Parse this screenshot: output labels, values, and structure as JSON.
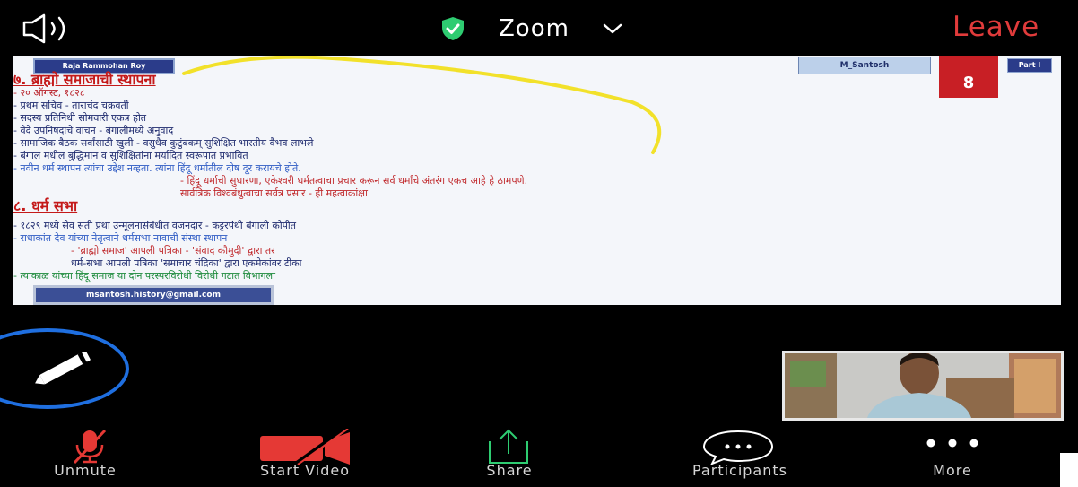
{
  "topbar": {
    "title": "Zoom",
    "leave_label": "Leave",
    "leave_color": "#e03b3b",
    "shield_color": "#2ecc71",
    "icons": [
      "speaker-icon",
      "encryption-shield-icon",
      "chevron-down-icon"
    ]
  },
  "slide": {
    "source_tag": "Raja Rammohan Roy",
    "presenter_tag": "M_Santosh",
    "page_number": "8",
    "part_label": "Part I",
    "section1_title": "७. ब्राह्मो समाजाची स्थापना",
    "section1_lines": [
      "- २० ऑगस्ट, १८२८",
      "- प्रथम सचिव - ताराचंद चक्रवर्ती",
      "- सदस्य प्रतिनिधी सोमवारी एकत्र होत",
      "- वेदे उपनिषदांचे वाचन - बंगालीमध्ये अनुवाद",
      "- सामाजिक बैठक सर्वांसाठी खुली - वसुधैव कुटुंबकम् सुशिक्षित भारतीय वैभव लाभले",
      "- बंगाल मधील बुद्धिमान व सुशिक्षितांना मर्यादित स्वरूपात प्रभावित",
      "- नवीन धर्म स्थापन त्यांचा उद्देश नव्हता. त्यांना हिंदू धर्मातील दोष दूर करायचे होते."
    ],
    "section1_sub": [
      "- हिंदू धर्माची सुधारणा, एकेश्वरी धर्मतत्वाचा प्रचार करून सर्व धर्मांचे अंतरंग एकच आहे हे ठामपणे.",
      "सार्वत्रिक विश्वबंधुत्वाचा सर्वत्र प्रसार - ही महत्वाकांक्षा"
    ],
    "section2_title": "८. धर्म सभा",
    "section2_lines": [
      "- १८२९ मध्ये सेव सती प्रथा उन्मूलनासंबंधीत वजनदार - कट्टरपंथी बंगाली कोपीत",
      "- राधाकांत देव यांच्या नेतृत्वाने धर्मसभा नावाची संस्था स्थापन",
      "- 'ब्राह्मो समाज' आपली पत्रिका - 'संवाद कौमुदी' द्वारा तर",
      "धर्म-सभा आपली पत्रिका 'समाचार चंद्रिका' द्वारा एकमेकांवर टीका",
      "- त्याकाळ यांच्या हिंदू समाज या दोन परस्परविरोधी विरोधी गटात विभागला"
    ],
    "email": "msantosh.history@gmail.com"
  },
  "annotation_tool": {
    "icon": "pencil-icon"
  },
  "toolbar": {
    "unmute_label": "Unmute",
    "start_video_label": "Start Video",
    "share_label": "Share",
    "participants_label": "Participants",
    "more_label": "More",
    "muted_color": "#e53935",
    "share_color": "#2ecc71"
  }
}
